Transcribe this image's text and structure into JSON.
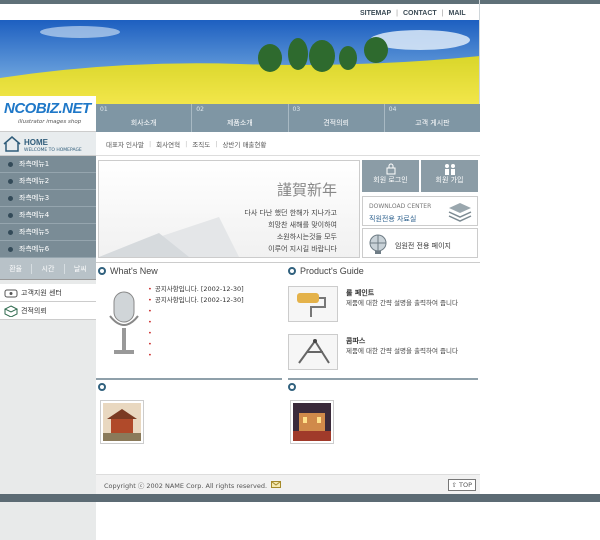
{
  "topnav": {
    "sitemap": "SITEMAP",
    "contact": "CONTACT",
    "mail": "MAIL"
  },
  "logo": {
    "name": "NCOBIZ.NET",
    "tagline": "illustrator images shop"
  },
  "mainmenu": [
    {
      "num": "01",
      "label": "회사소개"
    },
    {
      "num": "02",
      "label": "제품소개"
    },
    {
      "num": "03",
      "label": "견적의뢰"
    },
    {
      "num": "04",
      "label": "고객 게시판"
    }
  ],
  "submenu": [
    "대표자 인사말",
    "회사연혁",
    "조직도",
    "상반기 매출현황"
  ],
  "home": {
    "title": "HOME",
    "subtitle": "WELCOME TO HOMEPAGE"
  },
  "sidemenu": [
    "좌측메뉴1",
    "좌측메뉴2",
    "좌측메뉴3",
    "좌측메뉴4",
    "좌측메뉴5",
    "좌측메뉴6"
  ],
  "sidetabs": [
    "환율",
    "시간",
    "날씨"
  ],
  "sideboxes": [
    "고객지원 센터",
    "견적의뢰"
  ],
  "greeting": {
    "title": "謹賀新年",
    "message": "다사 다난 했던 한해가 지나가고\n희망찬 새해를 맞이하여\n소원하시는것들 모두\n이루어 지시길 바랍니다"
  },
  "buttons": {
    "login": "회원 로그인",
    "join": "회원 가입",
    "download_title": "DOWNLOAD CENTER",
    "download_sub": "직원전용 자료실",
    "member_page": "임원전 전용 페이지"
  },
  "whatsnew": {
    "title": "What's New",
    "items": [
      "공지사항입니다. [2002-12-30]",
      "공지사항입니다. [2002-12-30]",
      "",
      "",
      "",
      "",
      ""
    ]
  },
  "productguide": {
    "title": "Product's Guide",
    "items": [
      {
        "name": "롤 페인트",
        "desc": "제품에 대한 간략 설명을 출력하여 줍니다"
      },
      {
        "name": "콤파스",
        "desc": "제품에 대한 간략 설명을 출력하여 줍니다"
      }
    ]
  },
  "footer": {
    "copyright": "Copyright ⓒ 2002 NAME Corp. All rights reserved.",
    "top": "TOP"
  },
  "colors": {
    "menu": "#7f96a4",
    "sidemenu": "#7a8c96",
    "accent": "#31617e"
  }
}
